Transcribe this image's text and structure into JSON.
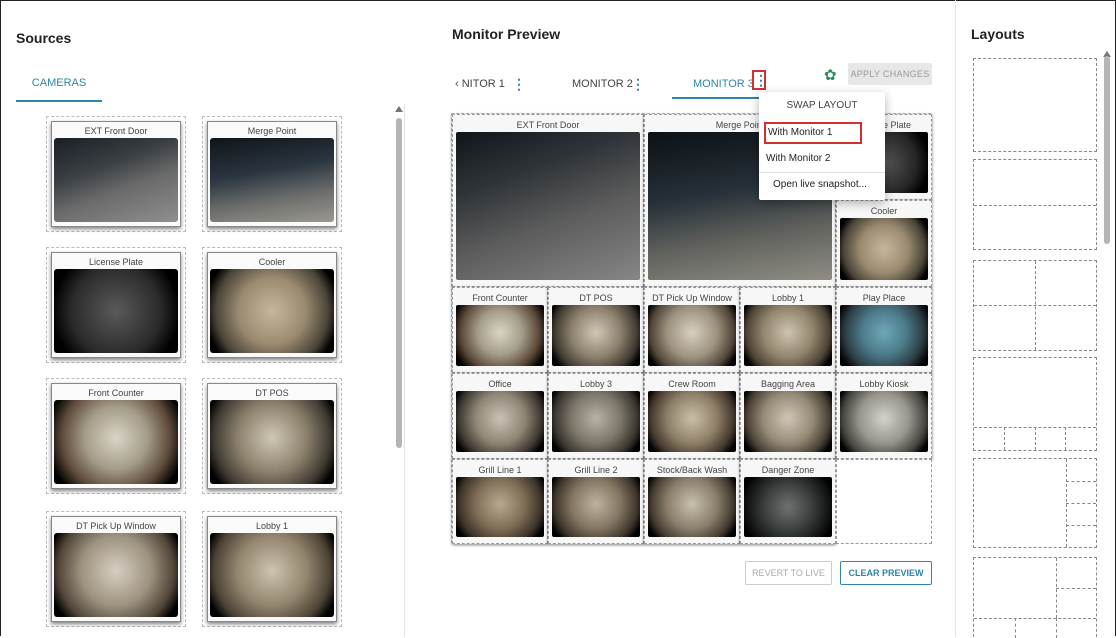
{
  "sources": {
    "title": "Sources",
    "tab_label": "CAMERAS",
    "cameras": [
      {
        "name": "EXT Front Door"
      },
      {
        "name": "Merge Point"
      },
      {
        "name": "License Plate"
      },
      {
        "name": "Cooler"
      },
      {
        "name": "Front Counter"
      },
      {
        "name": "DT POS"
      },
      {
        "name": "DT Pick Up Window"
      },
      {
        "name": "Lobby 1"
      }
    ]
  },
  "monitor_preview": {
    "title": "Monitor Preview",
    "tabs": [
      {
        "label": "‹ NITOR 1"
      },
      {
        "label": "MONITOR 2"
      },
      {
        "label": "MONITOR 3"
      }
    ],
    "apply_label": "APPLY CHANGES",
    "revert_label": "REVERT TO LIVE",
    "clear_label": "CLEAR PREVIEW",
    "cells": [
      {
        "label": "EXT Front Door"
      },
      {
        "label": "Merge Point"
      },
      {
        "label": "License Plate"
      },
      {
        "label": "Cooler"
      },
      {
        "label": "Front Counter"
      },
      {
        "label": "DT POS"
      },
      {
        "label": "DT Pick Up Window"
      },
      {
        "label": "Lobby 1"
      },
      {
        "label": "Play Place"
      },
      {
        "label": "Office"
      },
      {
        "label": "Lobby 3"
      },
      {
        "label": "Crew Room"
      },
      {
        "label": "Bagging Area"
      },
      {
        "label": "Lobby Kiosk"
      },
      {
        "label": "Grill Line 1"
      },
      {
        "label": "Grill Line 2"
      },
      {
        "label": "Stock/Back Wash"
      },
      {
        "label": "Danger Zone"
      }
    ]
  },
  "menu": {
    "header": "SWAP LAYOUT",
    "items": [
      {
        "label": "With Monitor 1"
      },
      {
        "label": "With Monitor 2"
      },
      {
        "label": "Open live snapshot..."
      }
    ]
  },
  "layouts": {
    "title": "Layouts"
  },
  "colors": {
    "accent": "#2f86a6",
    "highlight": "#d32f2f",
    "gear": "#2f8a5e"
  }
}
